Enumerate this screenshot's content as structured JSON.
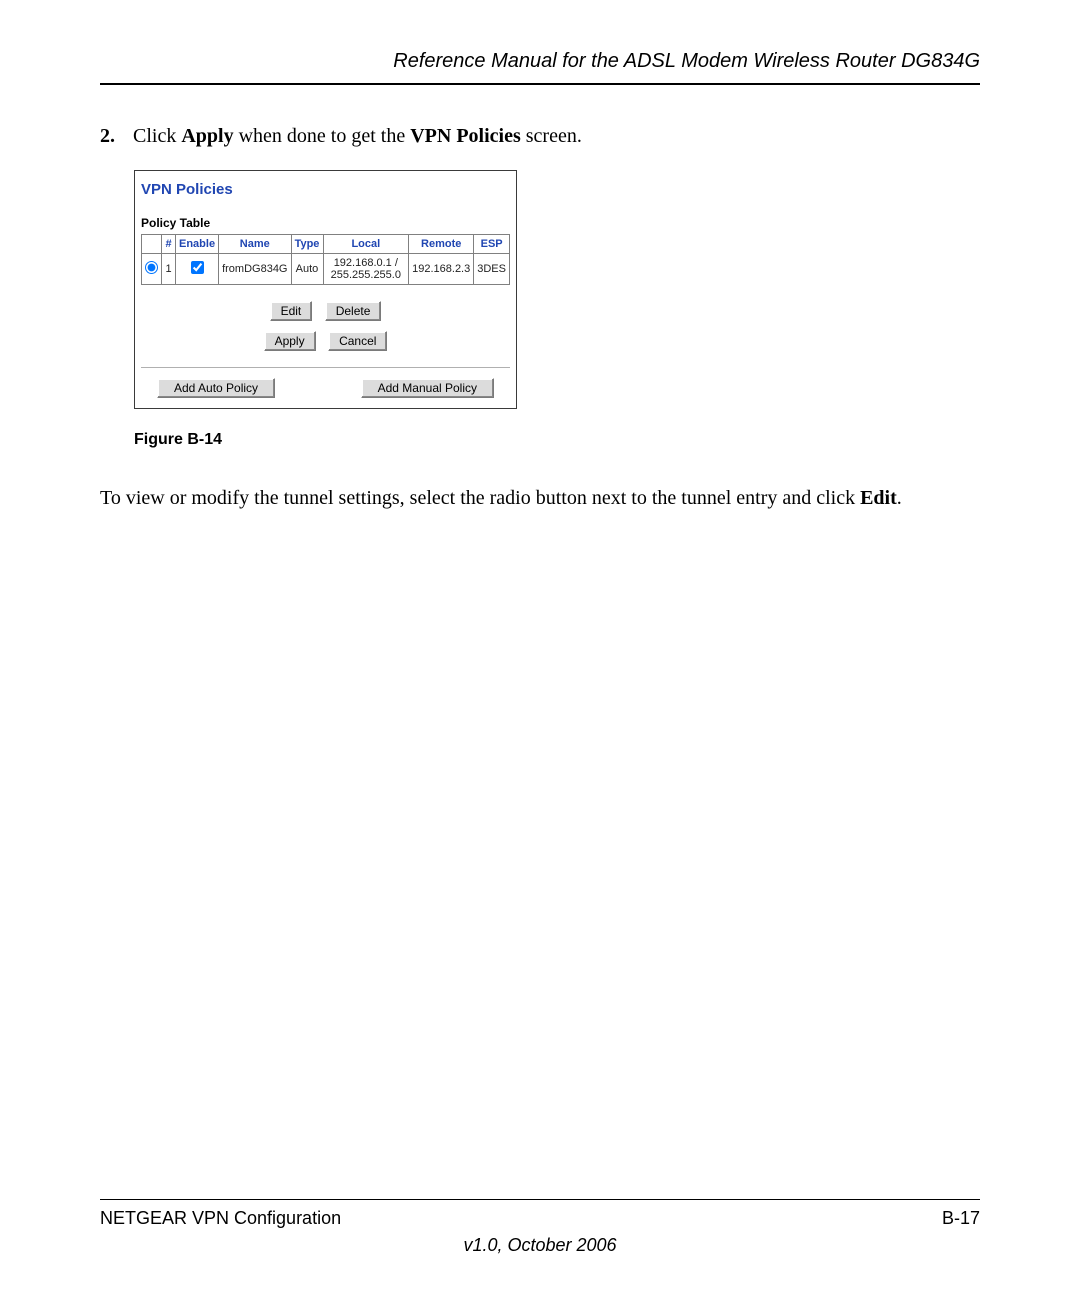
{
  "header": {
    "title": "Reference Manual for the ADSL Modem Wireless Router DG834G"
  },
  "step": {
    "number": "2.",
    "text_prefix": "Click ",
    "bold1": "Apply",
    "text_mid": " when done to get the ",
    "bold2": "VPN Policies",
    "text_suffix": " screen."
  },
  "panel": {
    "title": "VPN Policies",
    "table_title": "Policy Table",
    "columns": {
      "sel": "",
      "num": "#",
      "enable": "Enable",
      "name": "Name",
      "type": "Type",
      "local": "Local",
      "remote": "Remote",
      "esp": "ESP"
    },
    "row": {
      "num": "1",
      "name": "fromDG834G",
      "type": "Auto",
      "local": "192.168.0.1 / 255.255.255.0",
      "remote": "192.168.2.3",
      "esp": "3DES"
    },
    "buttons": {
      "edit": "Edit",
      "delete": "Delete",
      "apply": "Apply",
      "cancel": "Cancel",
      "add_auto": "Add Auto Policy",
      "add_manual": "Add Manual Policy"
    }
  },
  "figure_caption": "Figure B-14",
  "body": {
    "line1_prefix": "To view or modify the tunnel settings, select the radio button next to the tunnel entry and click ",
    "line1_bold": "Edit",
    "line1_suffix": "."
  },
  "footer": {
    "left": "NETGEAR VPN Configuration",
    "right": "B-17",
    "version": "v1.0, October 2006"
  }
}
